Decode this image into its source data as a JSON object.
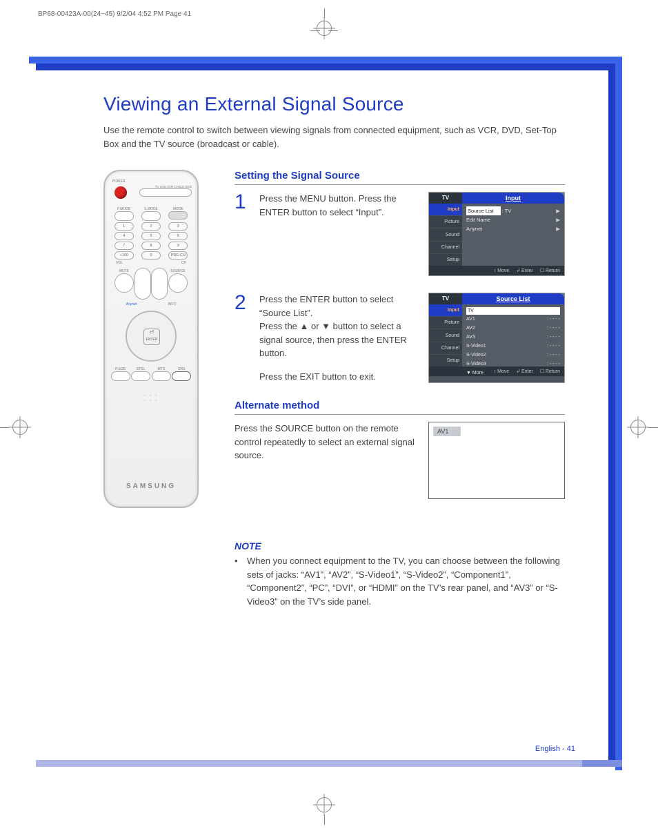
{
  "print_header": "BP68-00423A-00(24~45)  9/2/04  4:52 PM  Page 41",
  "title": "Viewing an External Signal Source",
  "intro": "Use the remote control to switch between viewing signals from connected equipment, such as VCR, DVD, Set-Top Box and the TV source (broadcast or cable).",
  "section1_head": "Setting the Signal Source",
  "step1_num": "1",
  "step1_text": "Press the MENU button. Press the ENTER button to select “Input”.",
  "step2_num": "2",
  "step2_text_a": "Press the ENTER button to select “Source List”.",
  "step2_text_b": "Press the ▲ or ▼ button to select a signal source, then press the ENTER button.",
  "step2_text_c": "Press the EXIT button to exit.",
  "alt_head": "Alternate method",
  "alt_text": "Press the SOURCE button on the remote control repeatedly to select an external signal source.",
  "note_head": "NOTE",
  "note_bullet": "•",
  "note_text": "When you connect equipment to the TV, you can choose between the following sets of jacks: “AV1”, “AV2”, “S-Video1”, “S-Video2”, “Component1”, “Component2”, “PC”, “DVI”, or “HDMI” on the TV’s rear panel, and “AV3” or “S-Video3” on the TV’s side panel.",
  "footer": "English - 41",
  "remote": {
    "brand": "SAMSUNG",
    "power_label": "POWER",
    "selector_labels": "TV   STB   VCR   CABLE   DVD",
    "mode_row": [
      "P.MODE",
      "S.MODE",
      "MODE"
    ],
    "nums_r1": [
      "1",
      "2",
      "3"
    ],
    "nums_r2": [
      "4",
      "5",
      "6"
    ],
    "nums_r3": [
      "7",
      "8",
      "9"
    ],
    "nums_r4": [
      "+100",
      "0",
      "PRE-CH"
    ],
    "vol_label": "VOL",
    "ch_label": "CH",
    "mute_label": "MUTE",
    "source_label": "SOURCE",
    "anynet_label": "Anynet",
    "info_label": "INFO",
    "enter_label": "ENTER",
    "bottom_row": [
      "P.SIZE",
      "STILL",
      "MTS",
      "SRS"
    ]
  },
  "osd1": {
    "tab_tv": "TV",
    "tab_title": "Input",
    "menu": [
      "Input",
      "Picture",
      "Sound",
      "Channel",
      "Setup"
    ],
    "lines": [
      {
        "label": "Source List",
        "value": ": TV",
        "arrow": "▶"
      },
      {
        "label": "Edit Name",
        "value": "",
        "arrow": "▶"
      },
      {
        "label": "Anynet",
        "value": "",
        "arrow": "▶"
      }
    ],
    "foot": [
      "↕ Move",
      "↲ Enter",
      "☐ Return"
    ]
  },
  "osd2": {
    "tab_tv": "TV",
    "tab_title": "Source List",
    "menu": [
      "Input",
      "Picture",
      "Sound",
      "Channel",
      "Setup"
    ],
    "highlight": "TV",
    "lines": [
      {
        "label": "AV1",
        "value": ": - - - -"
      },
      {
        "label": "AV2",
        "value": ": - - - -"
      },
      {
        "label": "AV3",
        "value": ": - - - -"
      },
      {
        "label": "S-Video1",
        "value": ": - - - -"
      },
      {
        "label": "S-Video2",
        "value": ": - - - -"
      },
      {
        "label": "S-Video3",
        "value": ": - - - -"
      },
      {
        "label": "▼ More",
        "value": ""
      }
    ],
    "foot": [
      "↕ Move",
      "↲ Enter",
      "☐ Return"
    ]
  },
  "alt_tag": "AV1"
}
